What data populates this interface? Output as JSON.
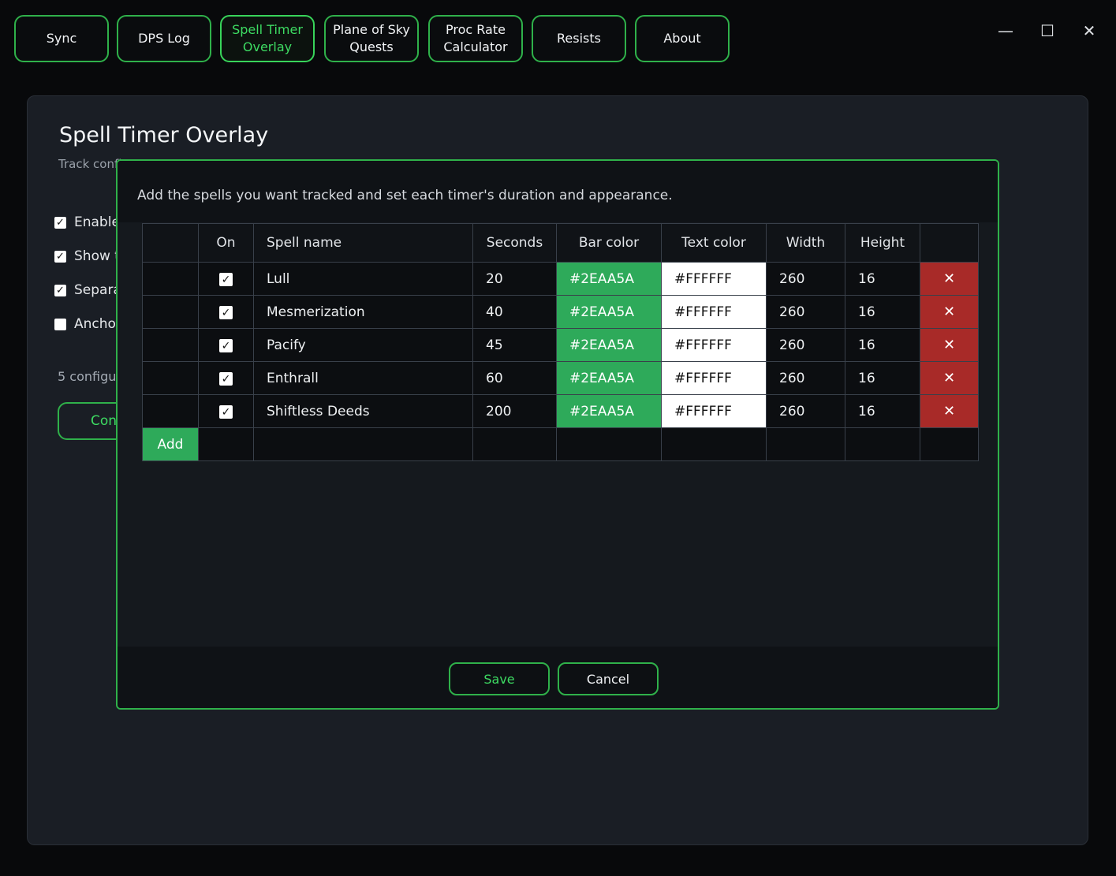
{
  "tabs": [
    {
      "label": "Sync"
    },
    {
      "label": "DPS Log"
    },
    {
      "label": "Spell Timer Overlay"
    },
    {
      "label": "Plane of Sky Quests"
    },
    {
      "label": "Proc Rate Calculator"
    },
    {
      "label": "Resists"
    },
    {
      "label": "About"
    }
  ],
  "active_tab": "Spell Timer Overlay",
  "window_controls": {
    "minimize": "—",
    "maximize": "☐",
    "close": "✕"
  },
  "panel": {
    "title": "Spell Timer Overlay",
    "subtitle": "Track confi",
    "options": [
      {
        "label": "Enable",
        "checked": true
      },
      {
        "label": "Show t",
        "checked": true
      },
      {
        "label": "Separa",
        "checked": true
      },
      {
        "label": "Ancho",
        "checked": false
      }
    ],
    "count_text": "5 configur",
    "config_button": "Con"
  },
  "modal": {
    "description": "Add the spells you want tracked and set each timer's duration and appearance.",
    "columns": [
      "",
      "On",
      "Spell name",
      "Seconds",
      "Bar color",
      "Text color",
      "Width",
      "Height",
      ""
    ],
    "rows": [
      {
        "on": true,
        "name": "Lull",
        "seconds": "20",
        "bar_color": "#2EAA5A",
        "text_color": "#FFFFFF",
        "width": "260",
        "height": "16"
      },
      {
        "on": true,
        "name": "Mesmerization",
        "seconds": "40",
        "bar_color": "#2EAA5A",
        "text_color": "#FFFFFF",
        "width": "260",
        "height": "16"
      },
      {
        "on": true,
        "name": "Pacify",
        "seconds": "45",
        "bar_color": "#2EAA5A",
        "text_color": "#FFFFFF",
        "width": "260",
        "height": "16"
      },
      {
        "on": true,
        "name": "Enthrall",
        "seconds": "60",
        "bar_color": "#2EAA5A",
        "text_color": "#FFFFFF",
        "width": "260",
        "height": "16"
      },
      {
        "on": true,
        "name": "Shiftless Deeds",
        "seconds": "200",
        "bar_color": "#2EAA5A",
        "text_color": "#FFFFFF",
        "width": "260",
        "height": "16"
      }
    ],
    "delete_glyph": "✕",
    "checkbox_glyph": "✓",
    "add_label": "Add",
    "save_label": "Save",
    "cancel_label": "Cancel"
  },
  "colors": {
    "accent": "#2FB14A",
    "accent_text": "#3DDB62",
    "bar_fill": "#2EAA5A",
    "delete_fill": "#A82A28"
  }
}
